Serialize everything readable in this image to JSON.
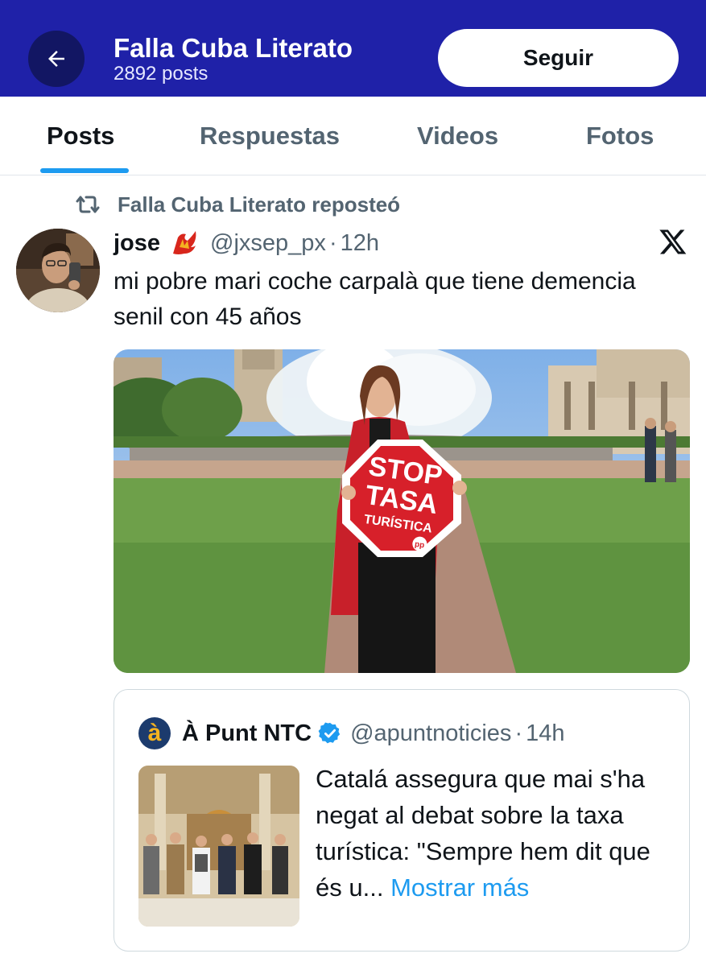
{
  "header": {
    "title": "Falla Cuba Literato",
    "subtitle": "2892 posts",
    "follow_label": "Seguir"
  },
  "tabs": [
    {
      "label": "Posts",
      "active": true
    },
    {
      "label": "Respuestas",
      "active": false
    },
    {
      "label": "Videos",
      "active": false
    },
    {
      "label": "Fotos",
      "active": false
    }
  ],
  "repost": {
    "text": "Falla Cuba Literato reposteó"
  },
  "post": {
    "author_name": "jose",
    "handle": "@jxsep_px",
    "separator": "·",
    "time": "12h",
    "text": "mi pobre mari coche carpalà que tiene demencia senil con 45 años",
    "image": {
      "sign_line1": "STOP",
      "sign_line2": "TASA",
      "sign_line3": "TURÍSTICA",
      "sign_logo": "pp"
    }
  },
  "quote": {
    "logo_glyph": "à",
    "name": "À Punt NTC",
    "handle": "@apuntnoticies",
    "separator": "·",
    "time": "14h",
    "text": "Catalá assegura que mai s'ha negat al debat sobre la taxa turística: \"Sempre hem dit que és u...",
    "more_label": "Mostrar más"
  },
  "colors": {
    "header_bg": "#1f21a8",
    "accent": "#1d9bf0",
    "text_primary": "#0f1419",
    "text_secondary": "#536471"
  }
}
